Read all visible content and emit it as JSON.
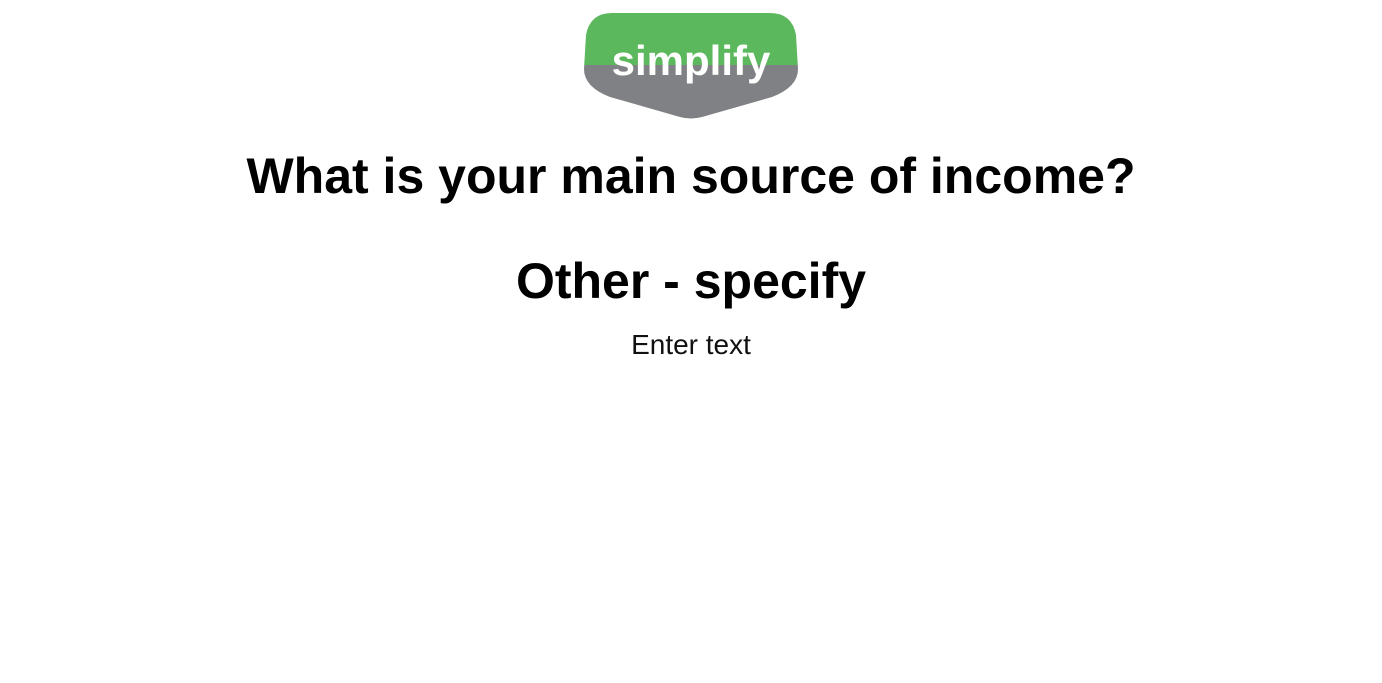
{
  "logo": {
    "text": "simplify",
    "colors": {
      "top": "#5cb85c",
      "bottom": "#808184",
      "text": "#ffffff"
    }
  },
  "question": {
    "title": "What is your main source of income?",
    "option_label": "Other - specify"
  },
  "answer_input": {
    "value": "",
    "placeholder": "Enter text"
  }
}
